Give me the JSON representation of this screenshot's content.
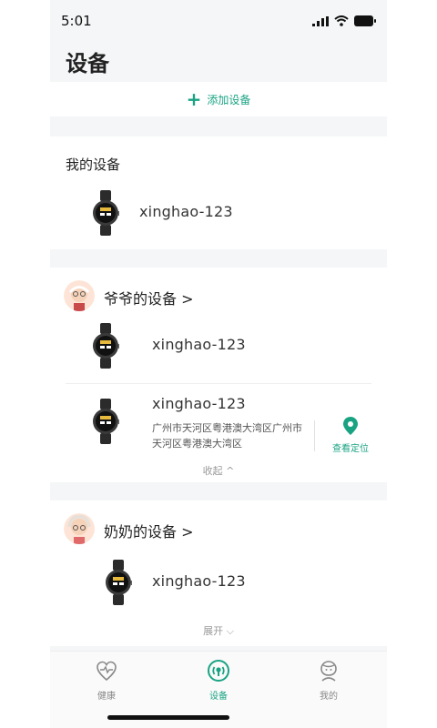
{
  "status": {
    "time": "5:01"
  },
  "page": {
    "title": "设备"
  },
  "add": {
    "label": "添加设备",
    "icon": "plus-icon"
  },
  "mine": {
    "title": "我的设备",
    "devices": [
      {
        "name": "xinghao-123"
      }
    ]
  },
  "grandpa": {
    "title": "爷爷的设备 >",
    "devices": [
      {
        "name": "xinghao-123"
      },
      {
        "name": "xinghao-123",
        "address": "广州市天河区粤港澳大湾区广州市天河区粤港澳大湾区",
        "locate_label": "查看定位"
      }
    ],
    "toggle_label": "收起 ^"
  },
  "grandma": {
    "title": "奶奶的设备 >",
    "devices": [
      {
        "name": "xinghao-123"
      }
    ],
    "toggle_label": "展开 ⌵"
  },
  "tabs": [
    {
      "label": "健康",
      "icon": "health-heart-icon",
      "active": false
    },
    {
      "label": "设备",
      "icon": "device-radio-icon",
      "active": true
    },
    {
      "label": "我的",
      "icon": "profile-face-icon",
      "active": false
    }
  ],
  "colors": {
    "accent": "#1aa383",
    "background": "#f4f6f7"
  }
}
